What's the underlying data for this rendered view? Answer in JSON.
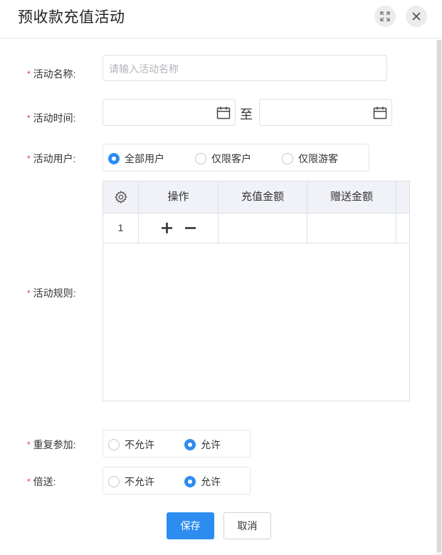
{
  "dialog": {
    "title": "预收款充值活动",
    "maximize_icon": "expand-icon",
    "close_icon": "close-icon"
  },
  "form": {
    "name": {
      "label": "活动名称:",
      "placeholder": "请输入活动名称",
      "value": ""
    },
    "time": {
      "label": "活动时间:",
      "start_value": "",
      "end_value": "",
      "separator": "至",
      "icon": "calendar-icon"
    },
    "users": {
      "label": "活动用户:",
      "options": [
        "全部用户",
        "仅限客户",
        "仅限游客"
      ],
      "selected": "全部用户"
    },
    "rules": {
      "label": "活动规则:",
      "columns": [
        "操作",
        "充值金额",
        "赠送金额"
      ],
      "settings_icon": "gear-icon",
      "rows": [
        {
          "index": "1",
          "recharge": "",
          "gift": ""
        }
      ],
      "add_icon": "plus-icon",
      "remove_icon": "minus-icon"
    },
    "repeat": {
      "label": "重复参加:",
      "options": [
        "不允许",
        "允许"
      ],
      "selected": "允许"
    },
    "double": {
      "label": "倍送:",
      "options": [
        "不允许",
        "允许"
      ],
      "selected": "允许"
    },
    "required_mark": "*"
  },
  "actions": {
    "save_label": "保存",
    "cancel_label": "取消"
  },
  "colors": {
    "accent": "#2d8cf0",
    "required": "#e4393c",
    "header_bg": "#f0f2f7"
  }
}
